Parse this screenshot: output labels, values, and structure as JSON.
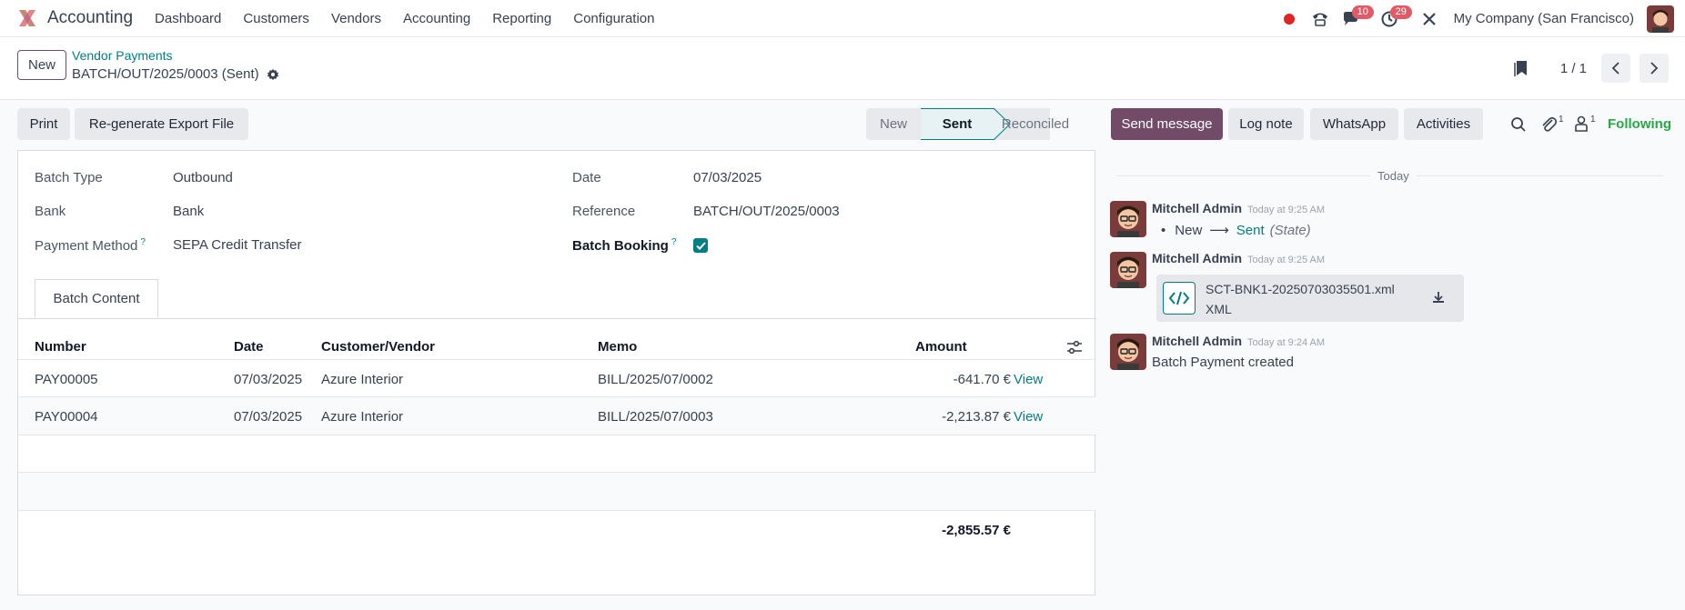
{
  "navbar": {
    "app_name": "Accounting",
    "menu": [
      "Dashboard",
      "Customers",
      "Vendors",
      "Accounting",
      "Reporting",
      "Configuration"
    ],
    "messages_badge": "10",
    "activities_badge": "29",
    "company": "My Company (San Francisco)"
  },
  "control": {
    "new_label": "New",
    "breadcrumb": "Vendor Payments",
    "record_title": "BATCH/OUT/2025/0003 (Sent)",
    "pager": "1 / 1"
  },
  "actions": {
    "print": "Print",
    "regenerate": "Re-generate Export File"
  },
  "status": {
    "steps": [
      "New",
      "Sent",
      "Reconciled"
    ],
    "active": "Sent"
  },
  "form": {
    "batch_type_label": "Batch Type",
    "batch_type": "Outbound",
    "bank_label": "Bank",
    "bank": "Bank",
    "payment_method_label": "Payment Method",
    "payment_method": "SEPA Credit Transfer",
    "date_label": "Date",
    "date": "07/03/2025",
    "reference_label": "Reference",
    "reference": "BATCH/OUT/2025/0003",
    "batch_booking_label": "Batch Booking",
    "batch_booking": true,
    "help_mark": "?",
    "tab": "Batch Content"
  },
  "table": {
    "columns": [
      "Number",
      "Date",
      "Customer/Vendor",
      "Memo",
      "Amount"
    ],
    "rows": [
      {
        "number": "PAY00005",
        "date": "07/03/2025",
        "partner": "Azure Interior",
        "memo": "BILL/2025/07/0002",
        "amount": "-641.70 €",
        "action": "View"
      },
      {
        "number": "PAY00004",
        "date": "07/03/2025",
        "partner": "Azure Interior",
        "memo": "BILL/2025/07/0003",
        "amount": "-2,213.87 €",
        "action": "View"
      }
    ],
    "total": "-2,855.57 €"
  },
  "chatter": {
    "send_message": "Send message",
    "log_note": "Log note",
    "whatsapp": "WhatsApp",
    "activities": "Activities",
    "attachments_count": "1",
    "followers_count": "1",
    "following": "Following",
    "today": "Today",
    "messages": [
      {
        "author": "Mitchell Admin",
        "time": "Today at 9:25 AM",
        "tracking_from": "New",
        "tracking_to": "Sent",
        "tracking_field": "(State)"
      },
      {
        "author": "Mitchell Admin",
        "time": "Today at 9:25 AM",
        "attachment_name": "SCT-BNK1-20250703035501.xml",
        "attachment_type": "XML"
      },
      {
        "author": "Mitchell Admin",
        "time": "Today at 9:24 AM",
        "body": "Batch Payment created"
      }
    ]
  },
  "colors": {
    "brand": "#714b67",
    "accent": "#017e84",
    "badge": "#e05a67",
    "following": "#28a745"
  }
}
